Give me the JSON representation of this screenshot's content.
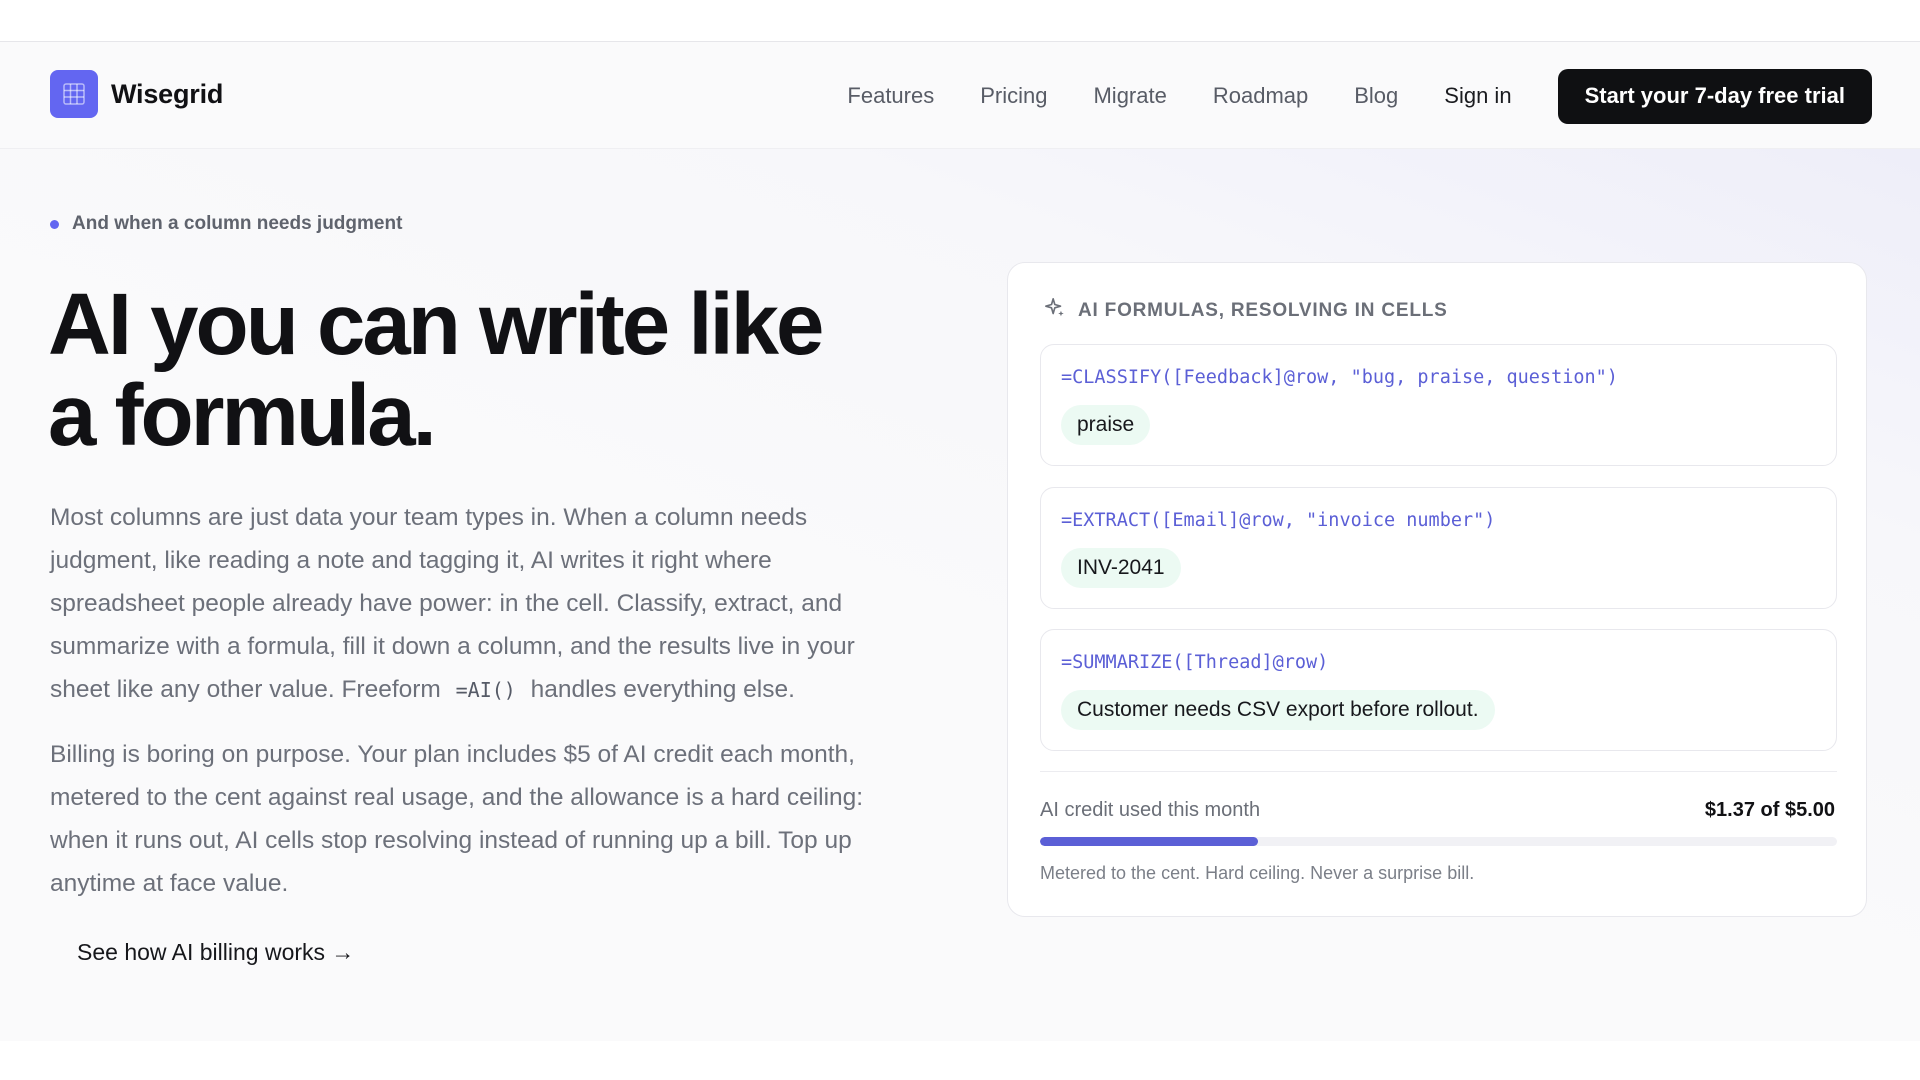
{
  "brand": {
    "name": "Wisegrid",
    "logo_icon": "grid-icon",
    "accent_color": "#6366f1"
  },
  "nav": {
    "links": [
      "Features",
      "Pricing",
      "Migrate",
      "Roadmap",
      "Blog"
    ],
    "sign_in": "Sign in",
    "cta": "Start your 7-day free trial"
  },
  "hero": {
    "eyebrow": "And when a column needs judgment",
    "headline_line1": "AI you can write like",
    "headline_line2": "a formula.",
    "body1_before": "Most columns are just data your team types in. When a column needs judgment, like reading a note and tagging it, AI writes it right where spreadsheet people already have power: in the cell. Classify, extract, and summarize with a formula, fill it down a column, and the results live in your sheet like any other value. Freeform",
    "body1_code": "=AI()",
    "body1_after": "handles everything else.",
    "body2": "Billing is boring on purpose. Your plan includes $5 of AI credit each month, metered to the cent against real usage, and the allowance is a hard ceiling: when it runs out, AI cells stop resolving instead of running up a bill. Top up anytime at face value.",
    "link": "See how AI billing works →"
  },
  "panel": {
    "title": "AI FORMULAS, RESOLVING IN CELLS",
    "title_icon": "sparkle-icon",
    "cards": [
      {
        "formula": "=CLASSIFY([Feedback]@row, \"bug, praise, question\")",
        "result": "praise"
      },
      {
        "formula": "=EXTRACT([Email]@row, \"invoice number\")",
        "result": "INV-2041"
      },
      {
        "formula": "=SUMMARIZE([Thread]@row)",
        "result": "Customer needs CSV export before rollout."
      }
    ],
    "credit_label": "AI credit used this month",
    "credit_value": "$1.37 of $5.00",
    "credit_used_fraction": 0.274,
    "credit_note": "Metered to the cent. Hard ceiling. Never a surprise bill."
  }
}
